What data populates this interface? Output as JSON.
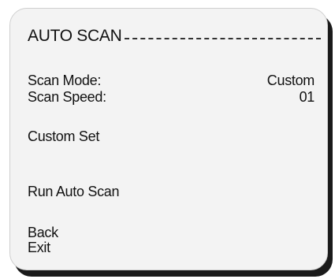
{
  "menu": {
    "title": "AUTO SCAN",
    "settings": [
      {
        "label": "Scan Mode:",
        "value": "Custom"
      },
      {
        "label": "Scan Speed:",
        "value": "01"
      }
    ],
    "custom_set": "Custom Set",
    "run_auto_scan": "Run Auto Scan",
    "back": "Back",
    "exit": "Exit"
  }
}
